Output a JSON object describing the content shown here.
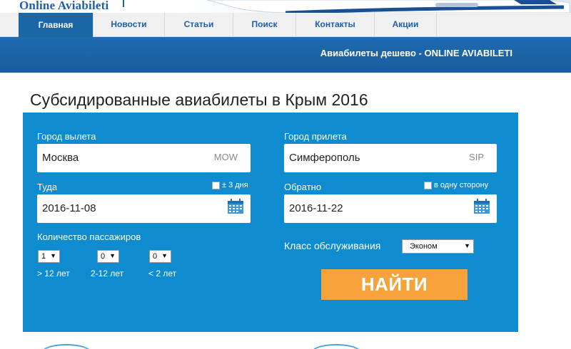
{
  "header": {
    "logo_text": "Online Aviabileti",
    "logo_mark": "!"
  },
  "nav": {
    "items": [
      {
        "label": "Главная",
        "active": true
      },
      {
        "label": "Новости",
        "active": false
      },
      {
        "label": "Статьи",
        "active": false
      },
      {
        "label": "Поиск",
        "active": false
      },
      {
        "label": "Контакты",
        "active": false
      },
      {
        "label": "Акции",
        "active": false
      }
    ]
  },
  "banner": {
    "text": "Авиабилеты дешево - ONLINE AVIABILETI"
  },
  "page": {
    "title": "Субсидированные авиабилеты в Крым 2016"
  },
  "form": {
    "from": {
      "label": "Город вылета",
      "value": "Москва",
      "code": "MOW"
    },
    "to": {
      "label": "Город прилета",
      "value": "Симферополь",
      "code": "SIP"
    },
    "depart": {
      "label": "Туда",
      "value": "2016-11-08",
      "flex_label": "± 3 дня"
    },
    "return": {
      "label": "Обратно",
      "value": "2016-11-22",
      "oneway_label": "в одну сторону"
    },
    "passengers": {
      "label": "Количество пассажиров",
      "adults": {
        "value": "1",
        "label": "> 12 лет"
      },
      "children": {
        "value": "0",
        "label": "2-12 лет"
      },
      "infants": {
        "value": "0",
        "label": "< 2 лет"
      }
    },
    "class": {
      "label": "Класс обслуживания",
      "value": "Эконом"
    },
    "submit_label": "НАЙТИ"
  },
  "colors": {
    "nav_active": "#1b67a6",
    "banner": "#1a5d9e",
    "panel": "#0f8ccf",
    "button": "#f8a23c"
  }
}
